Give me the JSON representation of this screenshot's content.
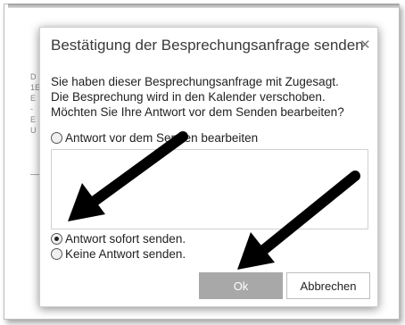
{
  "dialog": {
    "title": "Bestätigung der Besprechungsanfrage senden",
    "close_icon": "close-icon",
    "message_lines": [
      "Sie haben dieser Besprechungsanfrage mit Zugesagt.",
      "Die Besprechung wird in den Kalender verschoben.",
      "Möchten Sie Ihre Antwort vor dem Senden bearbeiten?"
    ],
    "options": [
      {
        "label": "Antwort vor dem Senden bearbeiten",
        "checked": false
      },
      {
        "label": "Antwort sofort senden.",
        "checked": true
      },
      {
        "label": "Keine Antwort senden.",
        "checked": false
      }
    ],
    "ok_label": "Ok",
    "cancel_label": "Abbrechen"
  },
  "background": {
    "fragments": [
      "D",
      "1E",
      "E",
      "-",
      "E",
      "U",
      "2",
      "E"
    ]
  },
  "colors": {
    "arrow": "#000000",
    "ok_button": "#a8a8a8",
    "dialog_border": "#cfcfcf"
  }
}
